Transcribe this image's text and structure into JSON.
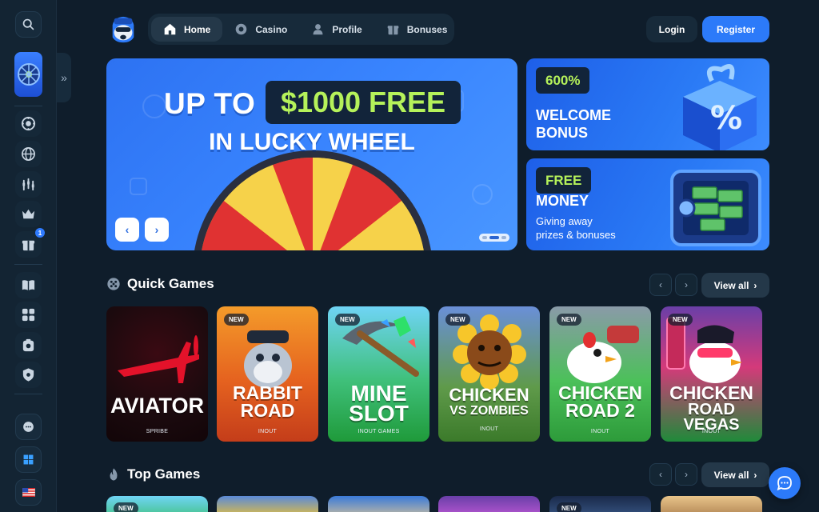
{
  "nav": {
    "items": [
      {
        "label": "Home",
        "icon": "home-icon",
        "active": true
      },
      {
        "label": "Casino",
        "icon": "casino-chip-icon",
        "active": false
      },
      {
        "label": "Profile",
        "icon": "profile-icon",
        "active": false
      },
      {
        "label": "Bonuses",
        "icon": "gift-icon",
        "active": false
      }
    ],
    "login_label": "Login",
    "register_label": "Register"
  },
  "sidebar": {
    "icons": [
      "search-icon",
      "casino-chip-icon",
      "globe-icon",
      "sports-icon",
      "crown-icon",
      "gift-icon",
      "book-icon",
      "games-icon",
      "bonus-box-icon",
      "shield-icon",
      "support-icon",
      "windows-icon",
      "us-flag-icon"
    ],
    "gift_badge": "1"
  },
  "hero": {
    "line1_prefix": "UP TO",
    "line1_highlight": "$1000 FREE",
    "line2": "IN LUCKY WHEEL"
  },
  "promos": [
    {
      "tag": "600%",
      "title_1": "WELCOME",
      "title_2": "BONUS"
    },
    {
      "tag": "FREE",
      "title_1": "MONEY",
      "sub_1": "Giving away",
      "sub_2": "prizes & bonuses"
    }
  ],
  "quick_games": {
    "title": "Quick Games",
    "view_all": "View all",
    "games": [
      {
        "name_1": "AVIATOR",
        "name_2": "",
        "provider": "SPRIBE",
        "new": false,
        "new_label": ""
      },
      {
        "name_1": "RABBIT",
        "name_2": "ROAD",
        "provider": "INOUT",
        "new": true,
        "new_label": "NEW"
      },
      {
        "name_1": "MINE",
        "name_2": "SLOT",
        "provider": "INOUT GAMES",
        "new": true,
        "new_label": "NEW"
      },
      {
        "name_1": "CHICKEN",
        "name_2": "VS ZOMBIES",
        "provider": "INOUT",
        "new": true,
        "new_label": "NEW"
      },
      {
        "name_1": "CHICKEN",
        "name_2": "ROAD 2",
        "provider": "INOUT",
        "new": true,
        "new_label": "NEW"
      },
      {
        "name_1": "CHICKEN",
        "name_2": "ROAD VEGAS",
        "provider": "INOUT",
        "new": true,
        "new_label": "NEW"
      }
    ]
  },
  "top_games": {
    "title": "Top Games",
    "view_all": "View all",
    "first_new": "NEW",
    "fifth_new": "NEW"
  },
  "colors": {
    "accent": "#2c7af9",
    "highlight_green": "#b5f25a",
    "background": "#0f1d2b"
  }
}
